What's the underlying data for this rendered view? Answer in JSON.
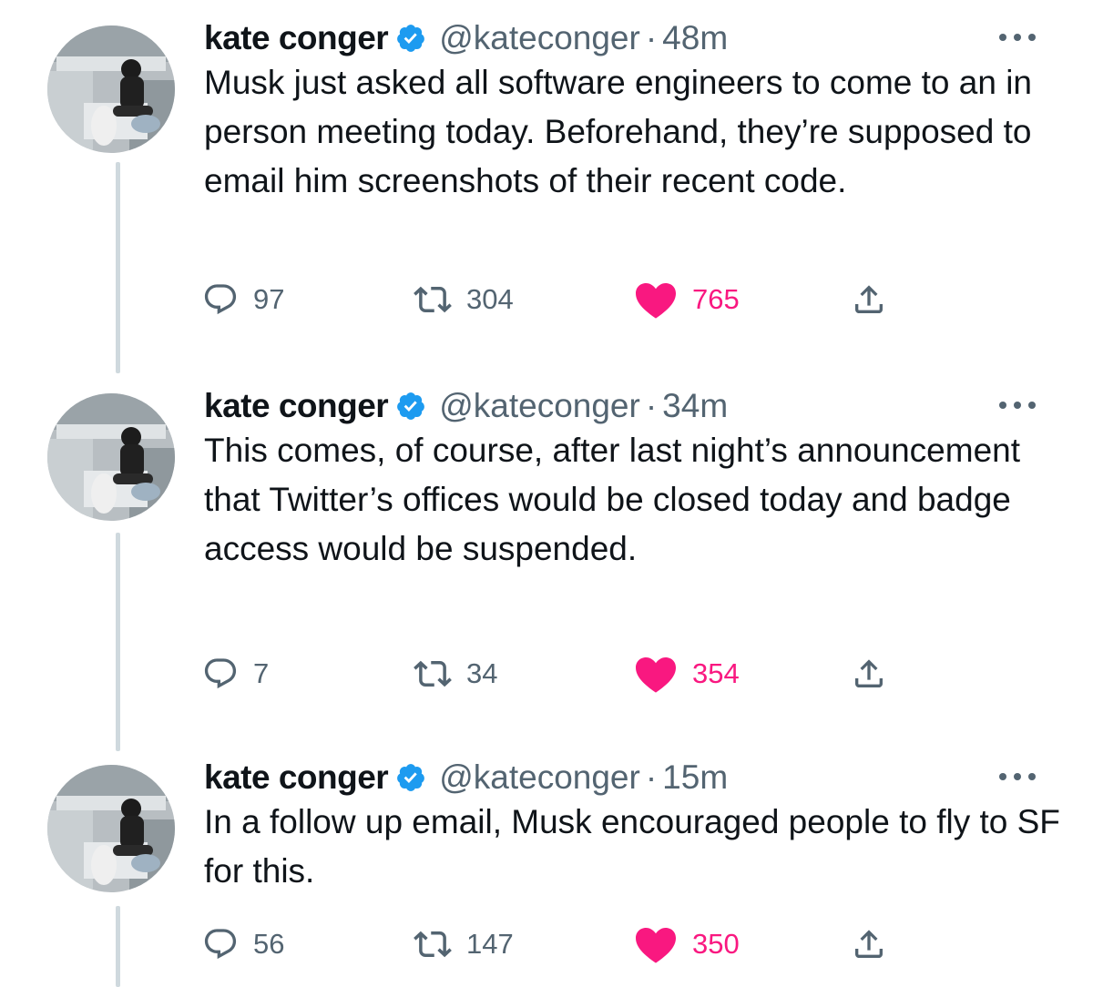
{
  "tweets": [
    {
      "display_name": "kate conger",
      "handle": "@kateconger",
      "dot": "·",
      "time": "48m",
      "text": "Musk just asked all software engineers to come to an in person meeting today. Beforehand, they’re supposed to email him screenshots of their recent code.",
      "replies": "97",
      "retweets": "304",
      "likes": "765"
    },
    {
      "display_name": "kate conger",
      "handle": "@kateconger",
      "dot": "·",
      "time": "34m",
      "text": "This comes, of course, after last night’s announcement that Twitter’s offices would be closed today and badge access would be suspended.",
      "replies": "7",
      "retweets": "34",
      "likes": "354"
    },
    {
      "display_name": "kate conger",
      "handle": "@kateconger",
      "dot": "·",
      "time": "15m",
      "text": "In a follow up email, Musk encouraged people to fly to SF for this.",
      "replies": "56",
      "retweets": "147",
      "likes": "350"
    }
  ],
  "icons": {
    "verified": "verified-badge-icon",
    "more": "more-options-icon",
    "reply": "reply-icon",
    "retweet": "retweet-icon",
    "like": "heart-icon",
    "share": "share-icon"
  },
  "colors": {
    "verified": "#1d9bf0",
    "like": "#f91880",
    "secondary_text": "#536471",
    "thread_line": "#cfd9de"
  }
}
